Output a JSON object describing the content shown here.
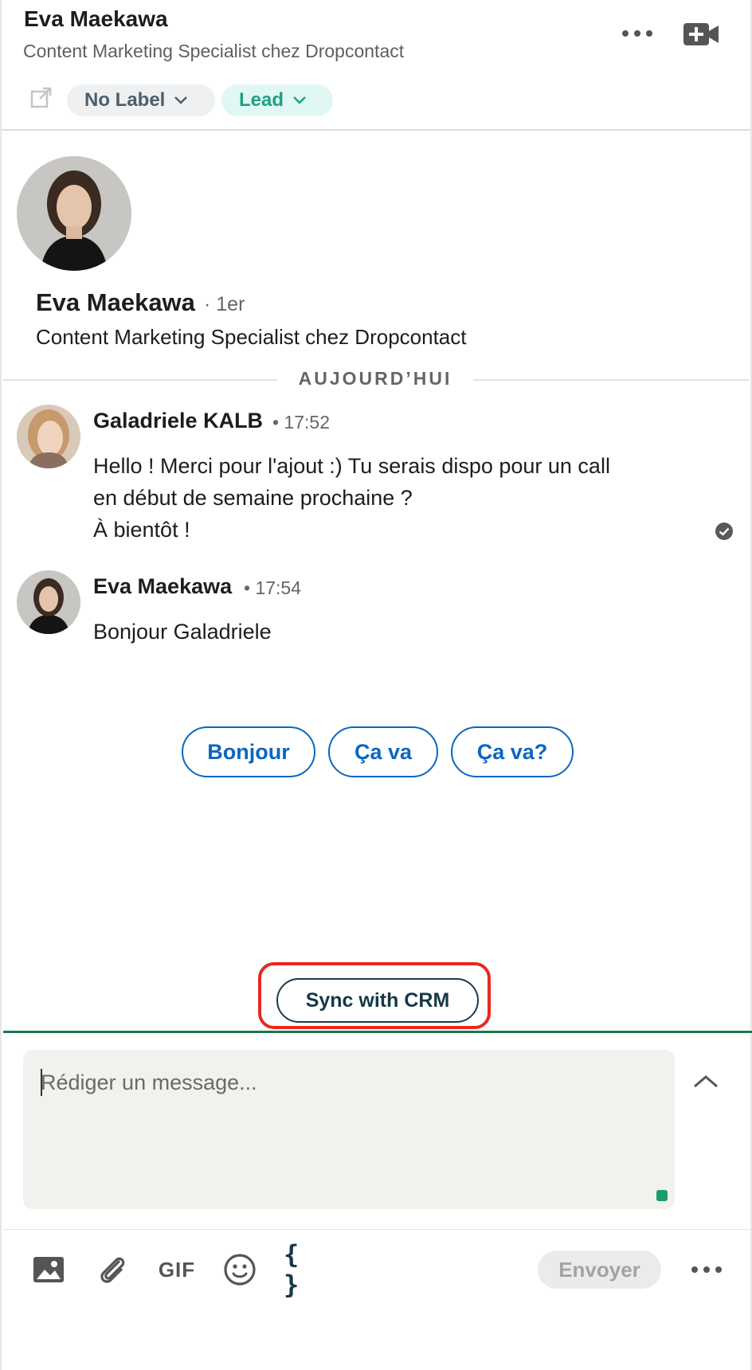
{
  "header": {
    "name": "Eva Maekawa",
    "subtitle": "Content Marketing Specialist chez Dropcontact",
    "more_icon": "more-horizontal-icon",
    "video_icon": "video-call-icon",
    "external_icon": "external-link-icon",
    "label_pill": "No Label",
    "status_pill": "Lead"
  },
  "profile": {
    "name": "Eva Maekawa",
    "degree": "· 1er",
    "title": "Content Marketing Specialist chez Dropcontact"
  },
  "divider": {
    "label": "AUJOURD’HUI"
  },
  "messages": [
    {
      "author": "Galadriele KALB",
      "time": "• 17:52",
      "lines": [
        "Hello ! Merci pour l'ajout :) Tu serais dispo pour un call",
        "en début de semaine prochaine ?",
        "À bientôt !"
      ],
      "read": true
    },
    {
      "author": "Eva Maekawa",
      "time": "• 17:54",
      "lines": [
        "Bonjour Galadriele"
      ]
    }
  ],
  "quick_replies": [
    "Bonjour",
    "Ça va",
    "Ça va?"
  ],
  "sync_button": {
    "label": "Sync with CRM"
  },
  "composer": {
    "placeholder": "Rédiger un message..."
  },
  "toolbar": {
    "gif_label": "GIF",
    "variables_label": "{ }",
    "send_label": "Envoyer",
    "icons": [
      "image-icon",
      "attachment-icon",
      "gif-icon",
      "emoji-icon",
      "variables-icon",
      "more-horizontal-icon"
    ]
  },
  "colors": {
    "accent_blue": "#0a66c2",
    "lead_green": "#1fa086",
    "highlight_red": "#e8291f",
    "composer_line": "#1a7a4c"
  }
}
